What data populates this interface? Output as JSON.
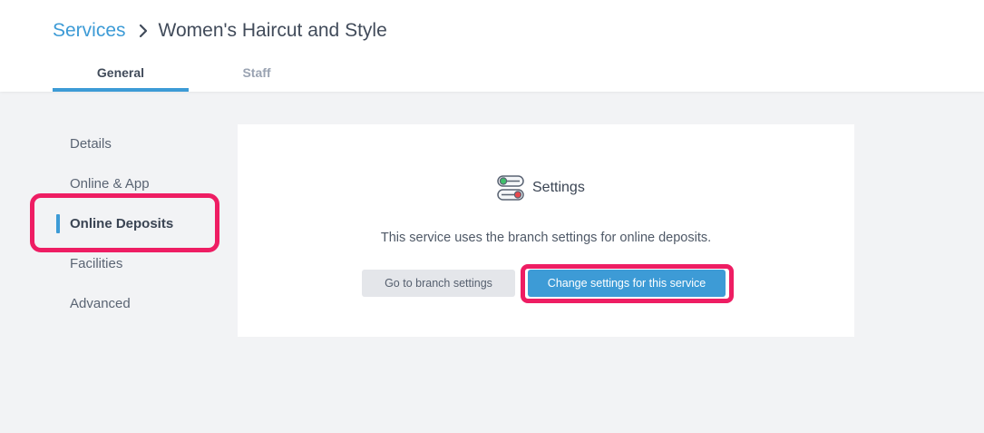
{
  "breadcrumb": {
    "parent": "Services",
    "current": "Women's Haircut and Style"
  },
  "tabs": [
    {
      "label": "General",
      "active": true
    },
    {
      "label": "Staff",
      "active": false
    }
  ],
  "sidenav": {
    "items": [
      {
        "label": "Details"
      },
      {
        "label": "Online & App"
      },
      {
        "label": "Online Deposits",
        "active": true
      },
      {
        "label": "Facilities"
      },
      {
        "label": "Advanced"
      }
    ]
  },
  "card": {
    "title": "Settings",
    "icon": "toggle-settings-icon",
    "description": "This service uses the branch settings for online deposits.",
    "secondary_button": "Go to branch settings",
    "primary_button": "Change settings for this service"
  },
  "colors": {
    "accent": "#3d9bd6",
    "highlight": "#ee1d63",
    "background": "#f2f3f5"
  }
}
